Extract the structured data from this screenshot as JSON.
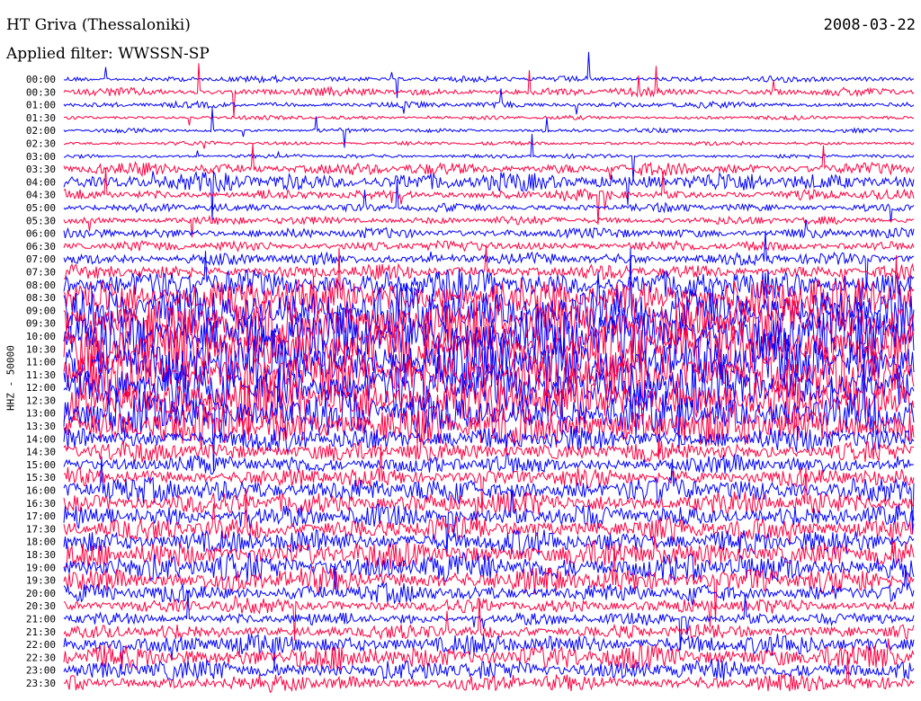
{
  "header": {
    "station": "HT Griva (Thessaloniki)",
    "filter": "Applied filter: WWSSN-SP",
    "date": "2008-03-22"
  },
  "chart_data": {
    "type": "line",
    "title": "HT Griva (Thessaloniki)",
    "subtitle": "Applied filter: WWSSN-SP",
    "ylabel": "HHZ - 50000",
    "row_labels": [
      "00:00",
      "00:30",
      "01:00",
      "01:30",
      "02:00",
      "02:30",
      "03:00",
      "03:30",
      "04:00",
      "04:30",
      "05:00",
      "05:30",
      "06:00",
      "06:30",
      "07:00",
      "07:30",
      "08:00",
      "08:30",
      "09:00",
      "09:30",
      "10:00",
      "10:30",
      "11:00",
      "11:30",
      "12:00",
      "12:30",
      "13:00",
      "13:30",
      "14:00",
      "14:30",
      "15:00",
      "15:30",
      "16:00",
      "16:30",
      "17:00",
      "17:30",
      "18:00",
      "18:30",
      "19:00",
      "19:30",
      "20:00",
      "20:30",
      "21:00",
      "21:30",
      "22:00",
      "22:30",
      "23:00",
      "23:30"
    ],
    "trace_colors": [
      "#0000ff",
      "#ff0040"
    ],
    "relative_amplitude": [
      3,
      4,
      3,
      2,
      2,
      2,
      2,
      6,
      9,
      5,
      4,
      4,
      5,
      5,
      6,
      7,
      14,
      20,
      24,
      26,
      28,
      28,
      28,
      26,
      24,
      24,
      22,
      20,
      12,
      10,
      9,
      9,
      12,
      11,
      11,
      11,
      12,
      13,
      14,
      12,
      9,
      7,
      6,
      7,
      10,
      12,
      10,
      8
    ]
  }
}
